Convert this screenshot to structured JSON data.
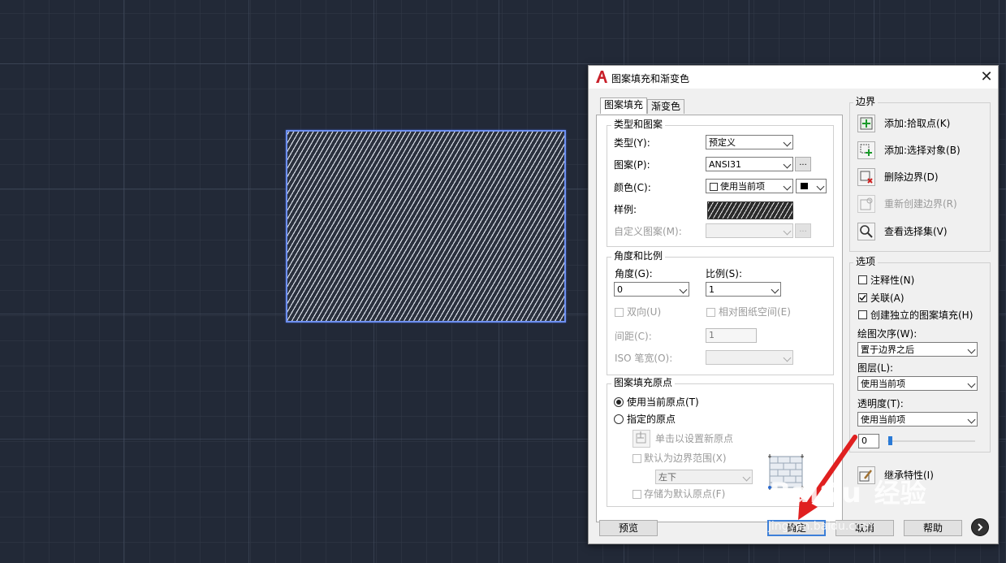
{
  "dialog": {
    "title": "图案填充和渐变色",
    "close_glyph": "✕",
    "tabs": [
      "图案填充",
      "渐变色"
    ],
    "type_pattern": {
      "group_title": "类型和图案",
      "type_label": "类型(Y):",
      "type_value": "预定义",
      "pattern_label": "图案(P):",
      "pattern_value": "ANSI31",
      "pattern_browse": "...",
      "color_label": "颜色(C):",
      "color_value": "使用当前项",
      "sample_label": "样例:",
      "custom_label": "自定义图案(M):",
      "custom_browse": "..."
    },
    "angle_scale": {
      "group_title": "角度和比例",
      "angle_label": "角度(G):",
      "angle_value": "0",
      "scale_label": "比例(S):",
      "scale_value": "1",
      "double_label": "双向(U)",
      "relative_label": "相对图纸空间(E)",
      "spacing_label": "间距(C):",
      "spacing_value": "1",
      "iso_label": "ISO 笔宽(O):"
    },
    "origin": {
      "group_title": "图案填充原点",
      "use_current": "使用当前原点(T)",
      "specified": "指定的原点",
      "click_set": "单击以设置新原点",
      "default_extent": "默认为边界范围(X)",
      "position_value": "左下",
      "store_default": "存储为默认原点(F)"
    },
    "boundaries": {
      "group_title": "边界",
      "add_pick": "添加:拾取点(K)",
      "add_select": "添加:选择对象(B)",
      "remove": "删除边界(D)",
      "recreate": "重新创建边界(R)",
      "view_selection": "查看选择集(V)"
    },
    "options": {
      "group_title": "选项",
      "annotative": "注释性(N)",
      "associative": "关联(A)",
      "associative_checked": true,
      "separate": "创建独立的图案填充(H)",
      "draw_order_label": "绘图次序(W):",
      "draw_order_value": "置于边界之后",
      "layer_label": "图层(L):",
      "layer_value": "使用当前项",
      "transparency_label": "透明度(T):",
      "transparency_value": "使用当前项",
      "transparency_level": "0"
    },
    "inherit": "继承特性(I)",
    "buttons": {
      "preview": "预览",
      "ok": "确定",
      "cancel": "取消",
      "help": "帮助"
    }
  },
  "watermark": {
    "brand": "Bai",
    "brand_end": "u",
    "cn": "经验",
    "url": "jingyan.baidu.com"
  },
  "colors": {
    "canvas_bg": "#222937",
    "hatch_border": "#6d8ff0",
    "annotation_arrow": "#e02020",
    "app_icon": "#c8202a"
  }
}
